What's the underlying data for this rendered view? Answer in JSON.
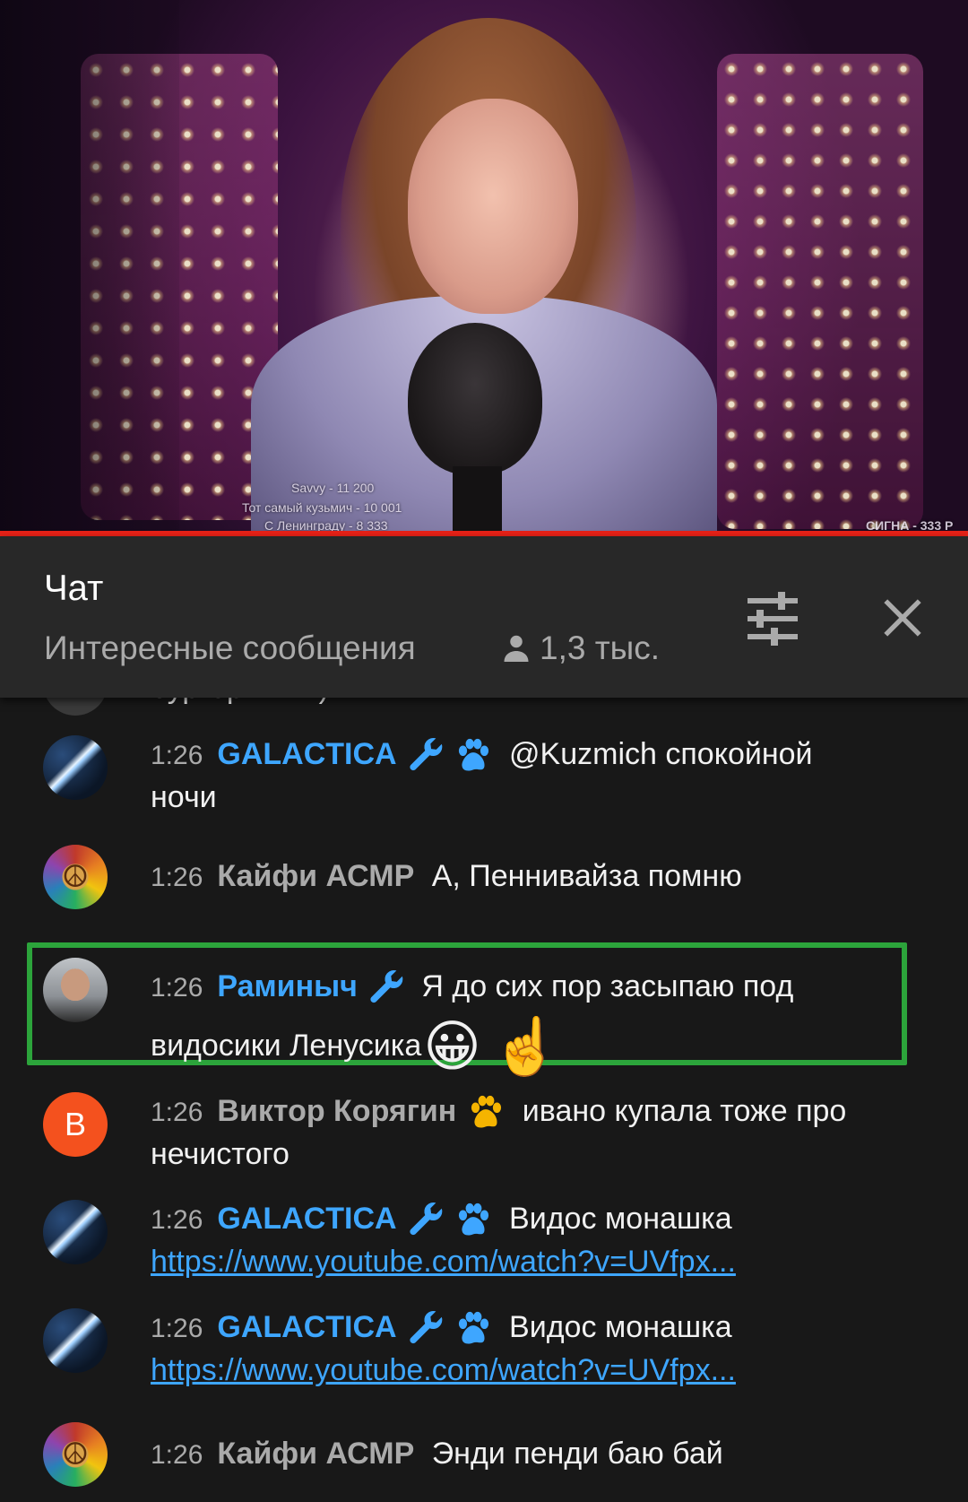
{
  "video": {
    "captions": {
      "line1": "Savvy - 11 200",
      "line2": "Тот самый кузьмич - 10 001",
      "line3": "С Ленинграду - 8 333",
      "corner": "СИГНА - 333 Р"
    }
  },
  "chat": {
    "title": "Чат",
    "mode": "Интересные сообщения",
    "viewers": "1,3 тыс.",
    "partial_text": "бургеркинг :)",
    "messages": [
      {
        "time": "1:26",
        "author": "GALACTICA",
        "text": "@Kuzmich спокойной ночи"
      },
      {
        "time": "1:26",
        "author": "Кайфи АСМР",
        "text": "А, Пеннивайза помню"
      },
      {
        "time": "1:26",
        "author": "Раминыч",
        "text": "Я до сих пор засыпаю под видосики Ленусика",
        "emoji1": "😀",
        "emoji2": "☝️"
      },
      {
        "time": "1:26",
        "author": "Виктор Корягин",
        "avatar_letter": "В",
        "text": "ивано купала тоже про нечистого"
      },
      {
        "time": "1:26",
        "author": "GALACTICA",
        "text": "Видос монашка",
        "link": "https://www.youtube.com/watch?v=UVfpx..."
      },
      {
        "time": "1:26",
        "author": "GALACTICA",
        "text": "Видос монашка",
        "link": "https://www.youtube.com/watch?v=UVfpx..."
      },
      {
        "time": "1:26",
        "author": "Кайфи АСМР",
        "text": "Энди пенди баю бай"
      }
    ]
  },
  "colors": {
    "background": "#181818",
    "header": "#282828",
    "moderator": "#3ea6ff",
    "highlight": "#2ca43b",
    "progress": "#e62117"
  },
  "icons": {
    "filter": "tune-sliders-icon",
    "close": "close-icon",
    "viewers": "person-icon",
    "moderator_badge": "wrench-icon",
    "member_badge": "paw-icon"
  }
}
